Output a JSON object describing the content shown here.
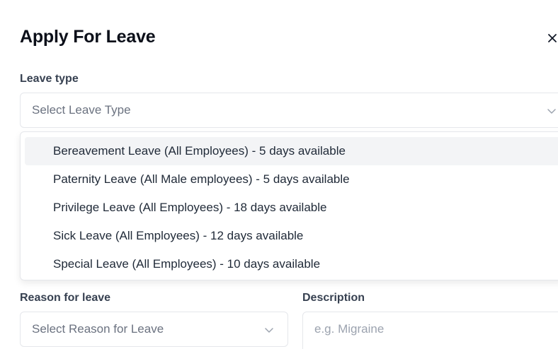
{
  "modal": {
    "title": "Apply For Leave",
    "close_icon": "close-icon"
  },
  "leave_type": {
    "label": "Leave type",
    "placeholder": "Select Leave Type",
    "options": [
      "Bereavement Leave (All Employees) - 5 days available",
      "Paternity Leave (All Male employees) - 5 days available",
      "Privilege Leave (All Employees) - 18 days available",
      "Sick Leave (All Employees) - 12 days available",
      "Special Leave (All Employees) - 10 days available"
    ],
    "highlighted_index": 0
  },
  "reason": {
    "label": "Reason for leave",
    "placeholder": "Select Reason for Leave"
  },
  "description": {
    "label": "Description",
    "placeholder": "e.g. Migraine"
  },
  "colors": {
    "highlight_bg": "#f3f4f6",
    "border": "#e5e7eb",
    "placeholder_text": "#6b7280"
  }
}
